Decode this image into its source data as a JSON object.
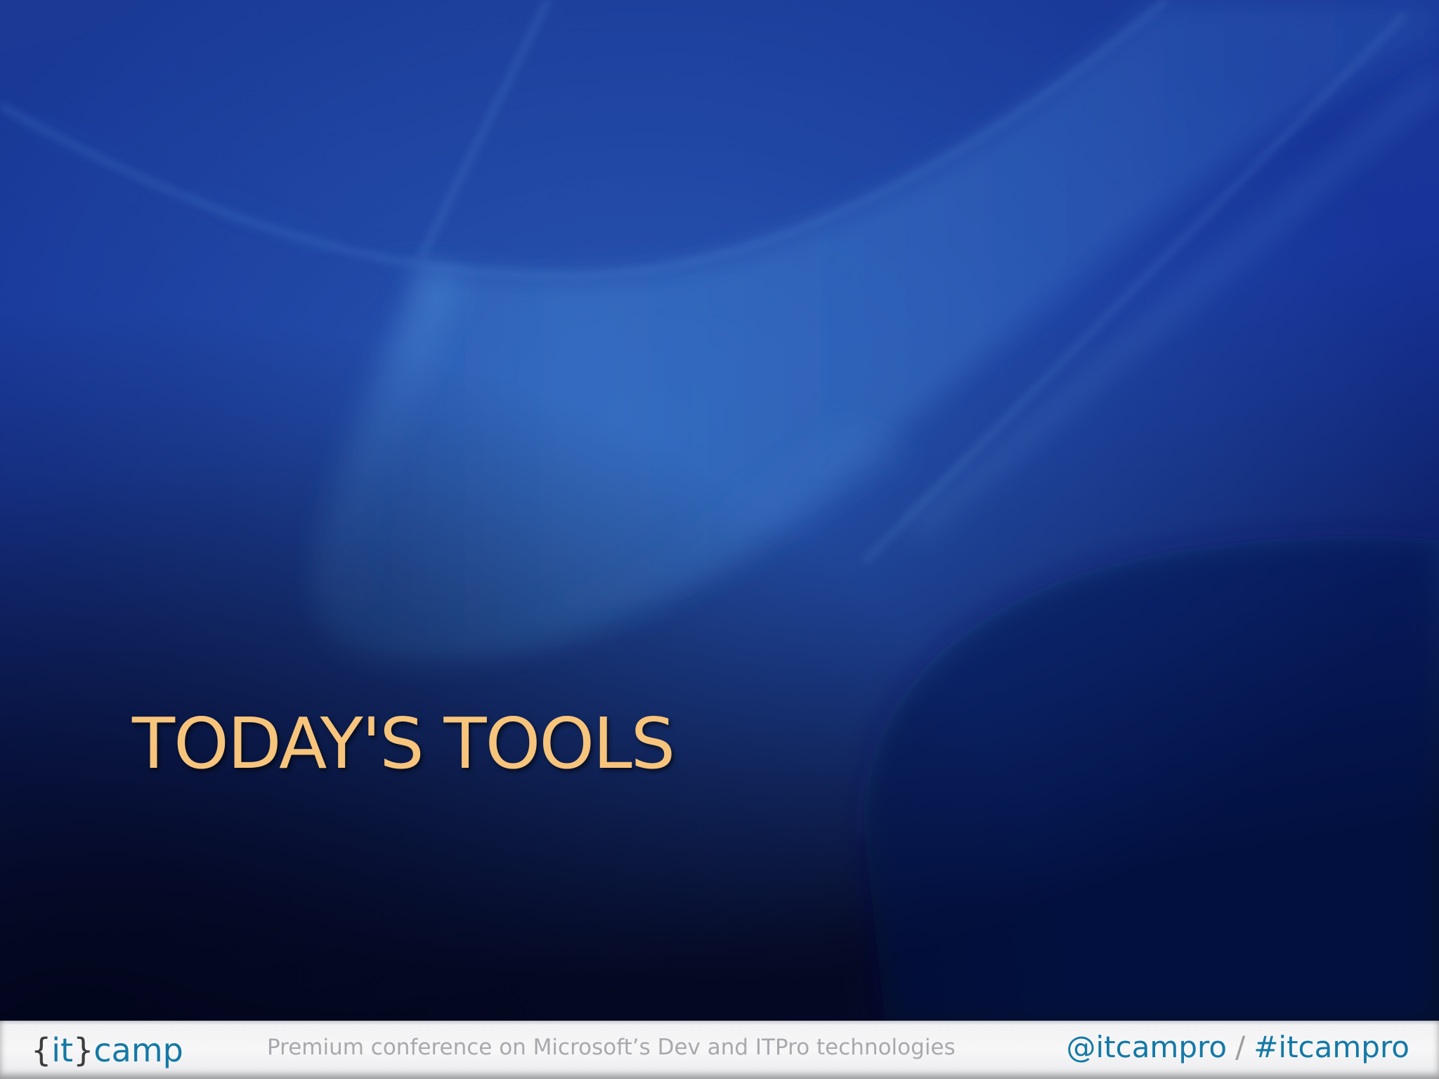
{
  "slide": {
    "title": "TODAY'S TOOLS"
  },
  "footer": {
    "logo": {
      "brace_open": "{",
      "it": "it",
      "brace_close": "}",
      "camp": "camp"
    },
    "tagline": "Premium conference on Microsoft’s Dev and ITPro technologies",
    "social": {
      "handle": "@itcampro",
      "separator": "/",
      "hashtag": "#itcampro"
    }
  },
  "colors": {
    "title": "#f7c47c",
    "background_dark": "#060c2a",
    "background_blue": "#1c3d9a",
    "footer_bg": "#f4f4f5",
    "brand_blue": "#1479a6",
    "tagline_gray": "#a8a9ad"
  }
}
